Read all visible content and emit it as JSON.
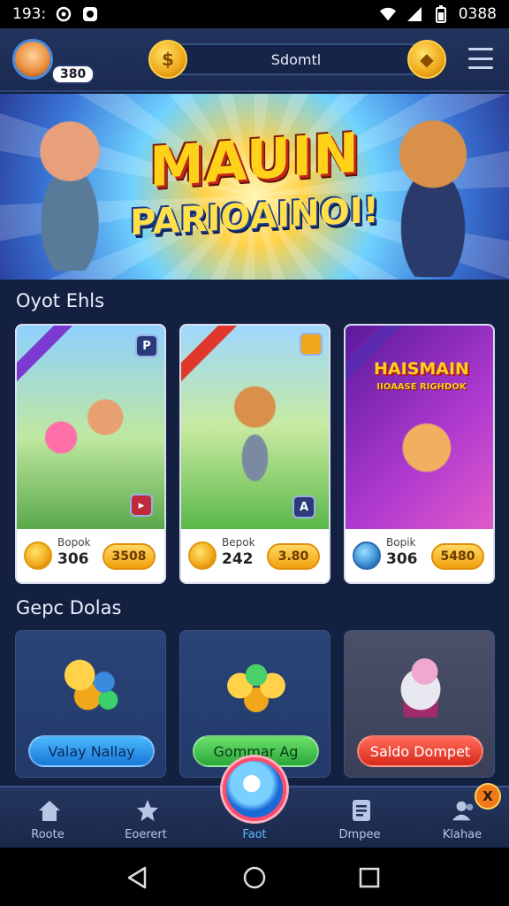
{
  "status": {
    "time": "193:",
    "battery": "0388"
  },
  "header": {
    "level": "380",
    "search_text": "Sdomtl"
  },
  "banner": {
    "title": "MAUIN",
    "subtitle": "PARIOAINOI!"
  },
  "sections": {
    "games_title": "Oyot Ehls",
    "deals_title": "Gepc Dolas"
  },
  "games": [
    {
      "ribbon": "",
      "corner": "P",
      "label": "Bopok",
      "count": "306",
      "price": "3508",
      "icon": "coin-icon"
    },
    {
      "ribbon": "",
      "corner": "A",
      "label": "Bepok",
      "count": "242",
      "price": "3.80",
      "icon": "coin-icon"
    },
    {
      "ribbon": "",
      "art_title": "HAISMAIN",
      "art_sub": "IIOAASE RIGHDOK",
      "label": "Bopik",
      "count": "306",
      "price": "5480",
      "icon": "globe-icon"
    }
  ],
  "deals": [
    {
      "button": "Valay Nallay",
      "style": "blue"
    },
    {
      "button": "Gommar Ag",
      "style": "green"
    },
    {
      "button": "Saldo Dompet",
      "style": "red"
    }
  ],
  "nav": [
    {
      "label": "Roote",
      "icon": "home-icon"
    },
    {
      "label": "Eoerert",
      "icon": "star-icon"
    },
    {
      "label": "Faot",
      "icon": "center-fab-icon"
    },
    {
      "label": "Dmpee",
      "icon": "document-icon"
    },
    {
      "label": "Klahae",
      "icon": "users-icon"
    }
  ],
  "notification_badge": "X",
  "colors": {
    "accent": "#5ab8ff",
    "coin": "#f0a81a",
    "background": "#13203f"
  }
}
